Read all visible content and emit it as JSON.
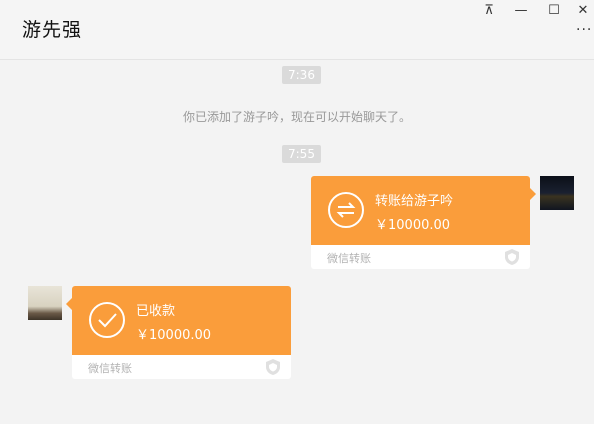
{
  "window": {
    "title": "游先强",
    "pin_label": "⊼",
    "min_label": "—",
    "max_label": "☐",
    "close_label": "✕",
    "more_label": "···"
  },
  "messages": {
    "time1": "7:36",
    "system_notice": "你已添加了游子吟，现在可以开始聊天了。",
    "time2": "7:55",
    "sent_transfer": {
      "title": "转账给游子吟",
      "amount": "￥10000.00",
      "footer": "微信转账",
      "icon": "transfer-arrows-icon"
    },
    "received_transfer": {
      "title": "已收款",
      "amount": "￥10000.00",
      "footer": "微信转账",
      "icon": "check-icon"
    }
  },
  "colors": {
    "accent": "#fa9d3b",
    "background": "#f3f3f3",
    "timestamp_bg": "#dadada"
  }
}
